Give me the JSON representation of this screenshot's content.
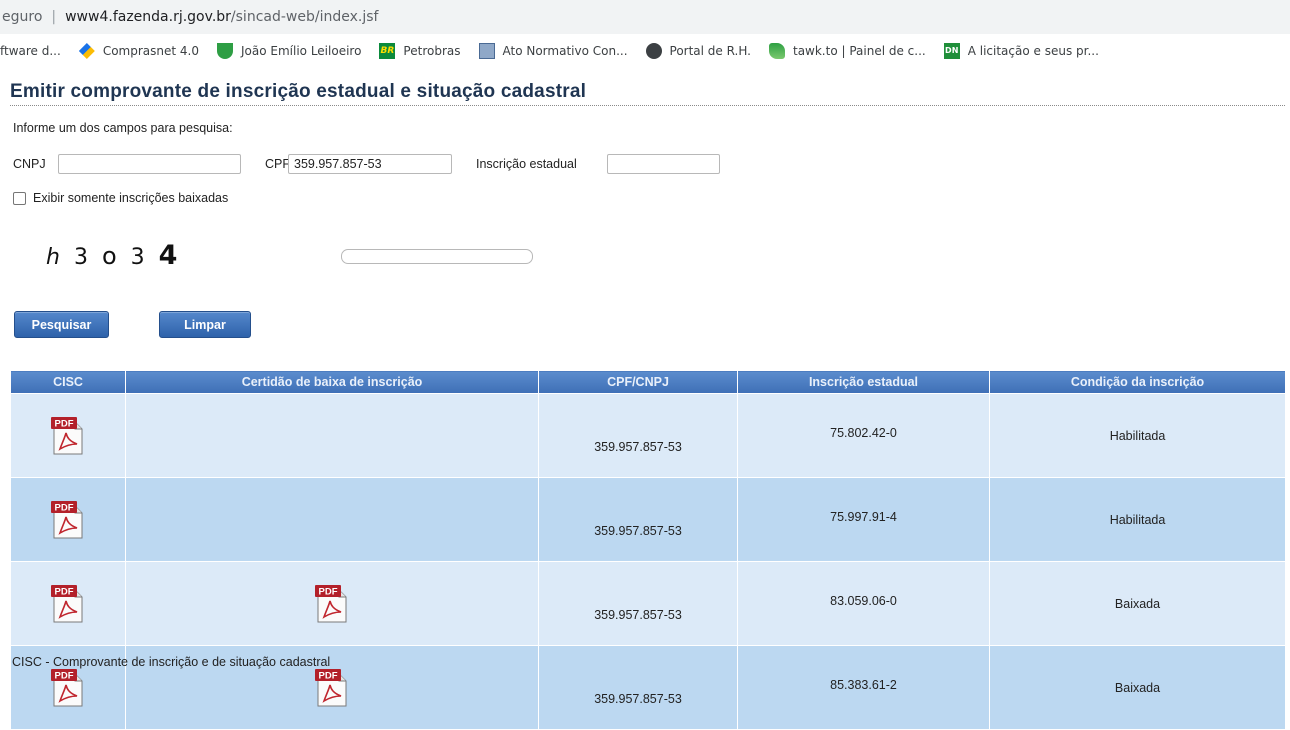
{
  "browser": {
    "security": "eguro",
    "url_domain": "www4.fazenda.rj.gov.br",
    "url_path": "/sincad-web/index.jsf",
    "bookmarks": [
      {
        "label": "ftware d...",
        "icon": "none"
      },
      {
        "label": "Comprasnet 4.0",
        "icon": "comprasnet-icon"
      },
      {
        "label": "João Emílio Leiloeiro",
        "icon": "joao-emilio-icon"
      },
      {
        "label": "Petrobras",
        "icon": "petrobras-icon"
      },
      {
        "label": "Ato Normativo Con...",
        "icon": "ato-normativo-icon"
      },
      {
        "label": "Portal de R.H.",
        "icon": "portal-rh-icon"
      },
      {
        "label": "tawk.to | Painel de c...",
        "icon": "tawk-icon"
      },
      {
        "label": "A licitação e seus pr...",
        "icon": "dn-icon"
      }
    ]
  },
  "page": {
    "title": "Emitir comprovante de inscrição estadual e situação cadastral",
    "instruction": "Informe um dos campos para pesquisa:"
  },
  "form": {
    "cnpj_label": "CNPJ",
    "cnpj_value": "",
    "cpf_label": "CPF",
    "cpf_value": "359.957.857-53",
    "ie_label": "Inscrição estadual",
    "ie_value": "",
    "only_closed_label": "Exibir somente inscrições baixadas",
    "only_closed_checked": false,
    "captcha_chars": [
      "h",
      "3",
      "o",
      "3",
      "4"
    ],
    "captcha_value": "",
    "search_label": "Pesquisar",
    "clear_label": "Limpar"
  },
  "table": {
    "headers": [
      "CISC",
      "Certidão de baixa de inscrição",
      "CPF/CNPJ",
      "Inscrição estadual",
      "Condição da inscrição"
    ],
    "pdf_badge": "PDF",
    "rows": [
      {
        "cisc_pdf": true,
        "certidao_pdf": false,
        "cpf_cnpj": "359.957.857-53",
        "inscricao": "75.802.42-0",
        "condicao": "Habilitada"
      },
      {
        "cisc_pdf": true,
        "certidao_pdf": false,
        "cpf_cnpj": "359.957.857-53",
        "inscricao": "75.997.91-4",
        "condicao": "Habilitada"
      },
      {
        "cisc_pdf": true,
        "certidao_pdf": true,
        "cpf_cnpj": "359.957.857-53",
        "inscricao": "83.059.06-0",
        "condicao": "Baixada"
      },
      {
        "cisc_pdf": true,
        "certidao_pdf": true,
        "cpf_cnpj": "359.957.857-53",
        "inscricao": "85.383.61-2",
        "condicao": "Baixada"
      }
    ]
  },
  "footnote": "CISC - Comprovante de inscrição e de situação cadastral"
}
